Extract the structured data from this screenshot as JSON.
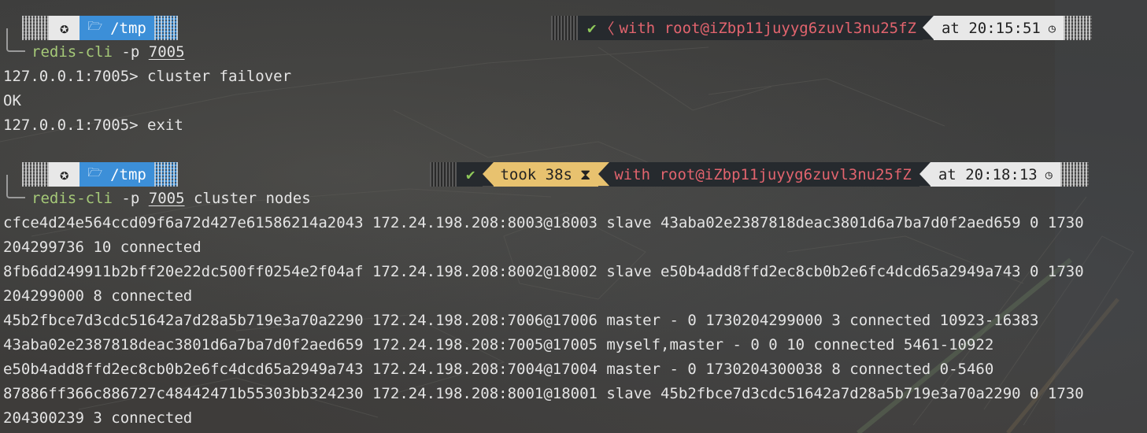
{
  "prompt1": {
    "os_icon": "gear-icon",
    "dir_icon": "folder-icon",
    "dir": "/tmp",
    "status_icon": "checkmark-icon",
    "status": "✔",
    "with_label": "with",
    "user_host": "root@iZbp11juyyg6zuvl3nu25fZ",
    "at_label": "at",
    "time": "20:15:51",
    "clock_icon": "clock-icon"
  },
  "command1": {
    "program": "redis-cli",
    "flag": "-p",
    "port": "7005",
    "args": ""
  },
  "session1": [
    {
      "prompt": "127.0.0.1:7005>",
      "input": " cluster failover"
    },
    {
      "output": "OK"
    },
    {
      "prompt": "127.0.0.1:7005>",
      "input": " exit"
    }
  ],
  "prompt2": {
    "os_icon": "gear-icon",
    "dir_icon": "folder-icon",
    "dir": "/tmp",
    "status": "✔",
    "took_label": "took",
    "duration": "38s",
    "hourglass_icon": "hourglass-icon",
    "with_label": "with",
    "user_host": "root@iZbp11juyyg6zuvl3nu25fZ",
    "at_label": "at",
    "time": "20:18:13",
    "clock_icon": "clock-icon"
  },
  "command2": {
    "program": "redis-cli",
    "flag": "-p",
    "port": "7005",
    "args": " cluster nodes"
  },
  "output_lines": [
    "cfce4d24e564ccd09f6a72d427e61586214a2043 172.24.198.208:8003@18003 slave 43aba02e2387818deac3801d6a7ba7d0f2aed659 0 1730",
    "204299736 10 connected",
    "8fb6dd249911b2bff20e22dc500ff0254e2f04af 172.24.198.208:8002@18002 slave e50b4add8ffd2ec8cb0b2e6fc4dcd65a2949a743 0 1730",
    "204299000 8 connected",
    "45b2fbce7d3cdc51642a7d28a5b719e3a70a2290 172.24.198.208:7006@17006 master - 0 1730204299000 3 connected 10923-16383",
    "43aba02e2387818deac3801d6a7ba7d0f2aed659 172.24.198.208:7005@17005 myself,master - 0 0 10 connected 5461-10922",
    "e50b4add8ffd2ec8cb0b2e6fc4dcd65a2949a743 172.24.198.208:7004@17004 master - 0 1730204300038 8 connected 0-5460",
    "87886ff366c886727c48442471b55303bb324230 172.24.198.208:8001@18001 slave 45b2fbce7d3cdc51642a7d28a5b719e3a70a2290 0 1730",
    "204300239 3 connected"
  ],
  "colors": {
    "background": "#3a3a39",
    "text": "#e4e4e4",
    "command": "#a5c978",
    "dir_segment": "#3c8fd8",
    "status_segment": "#262a2e",
    "status_ok": "#8fc95a",
    "user_host": "#e2646e",
    "took_segment": "#e8c26f",
    "light_segment": "#e8e8e8"
  }
}
